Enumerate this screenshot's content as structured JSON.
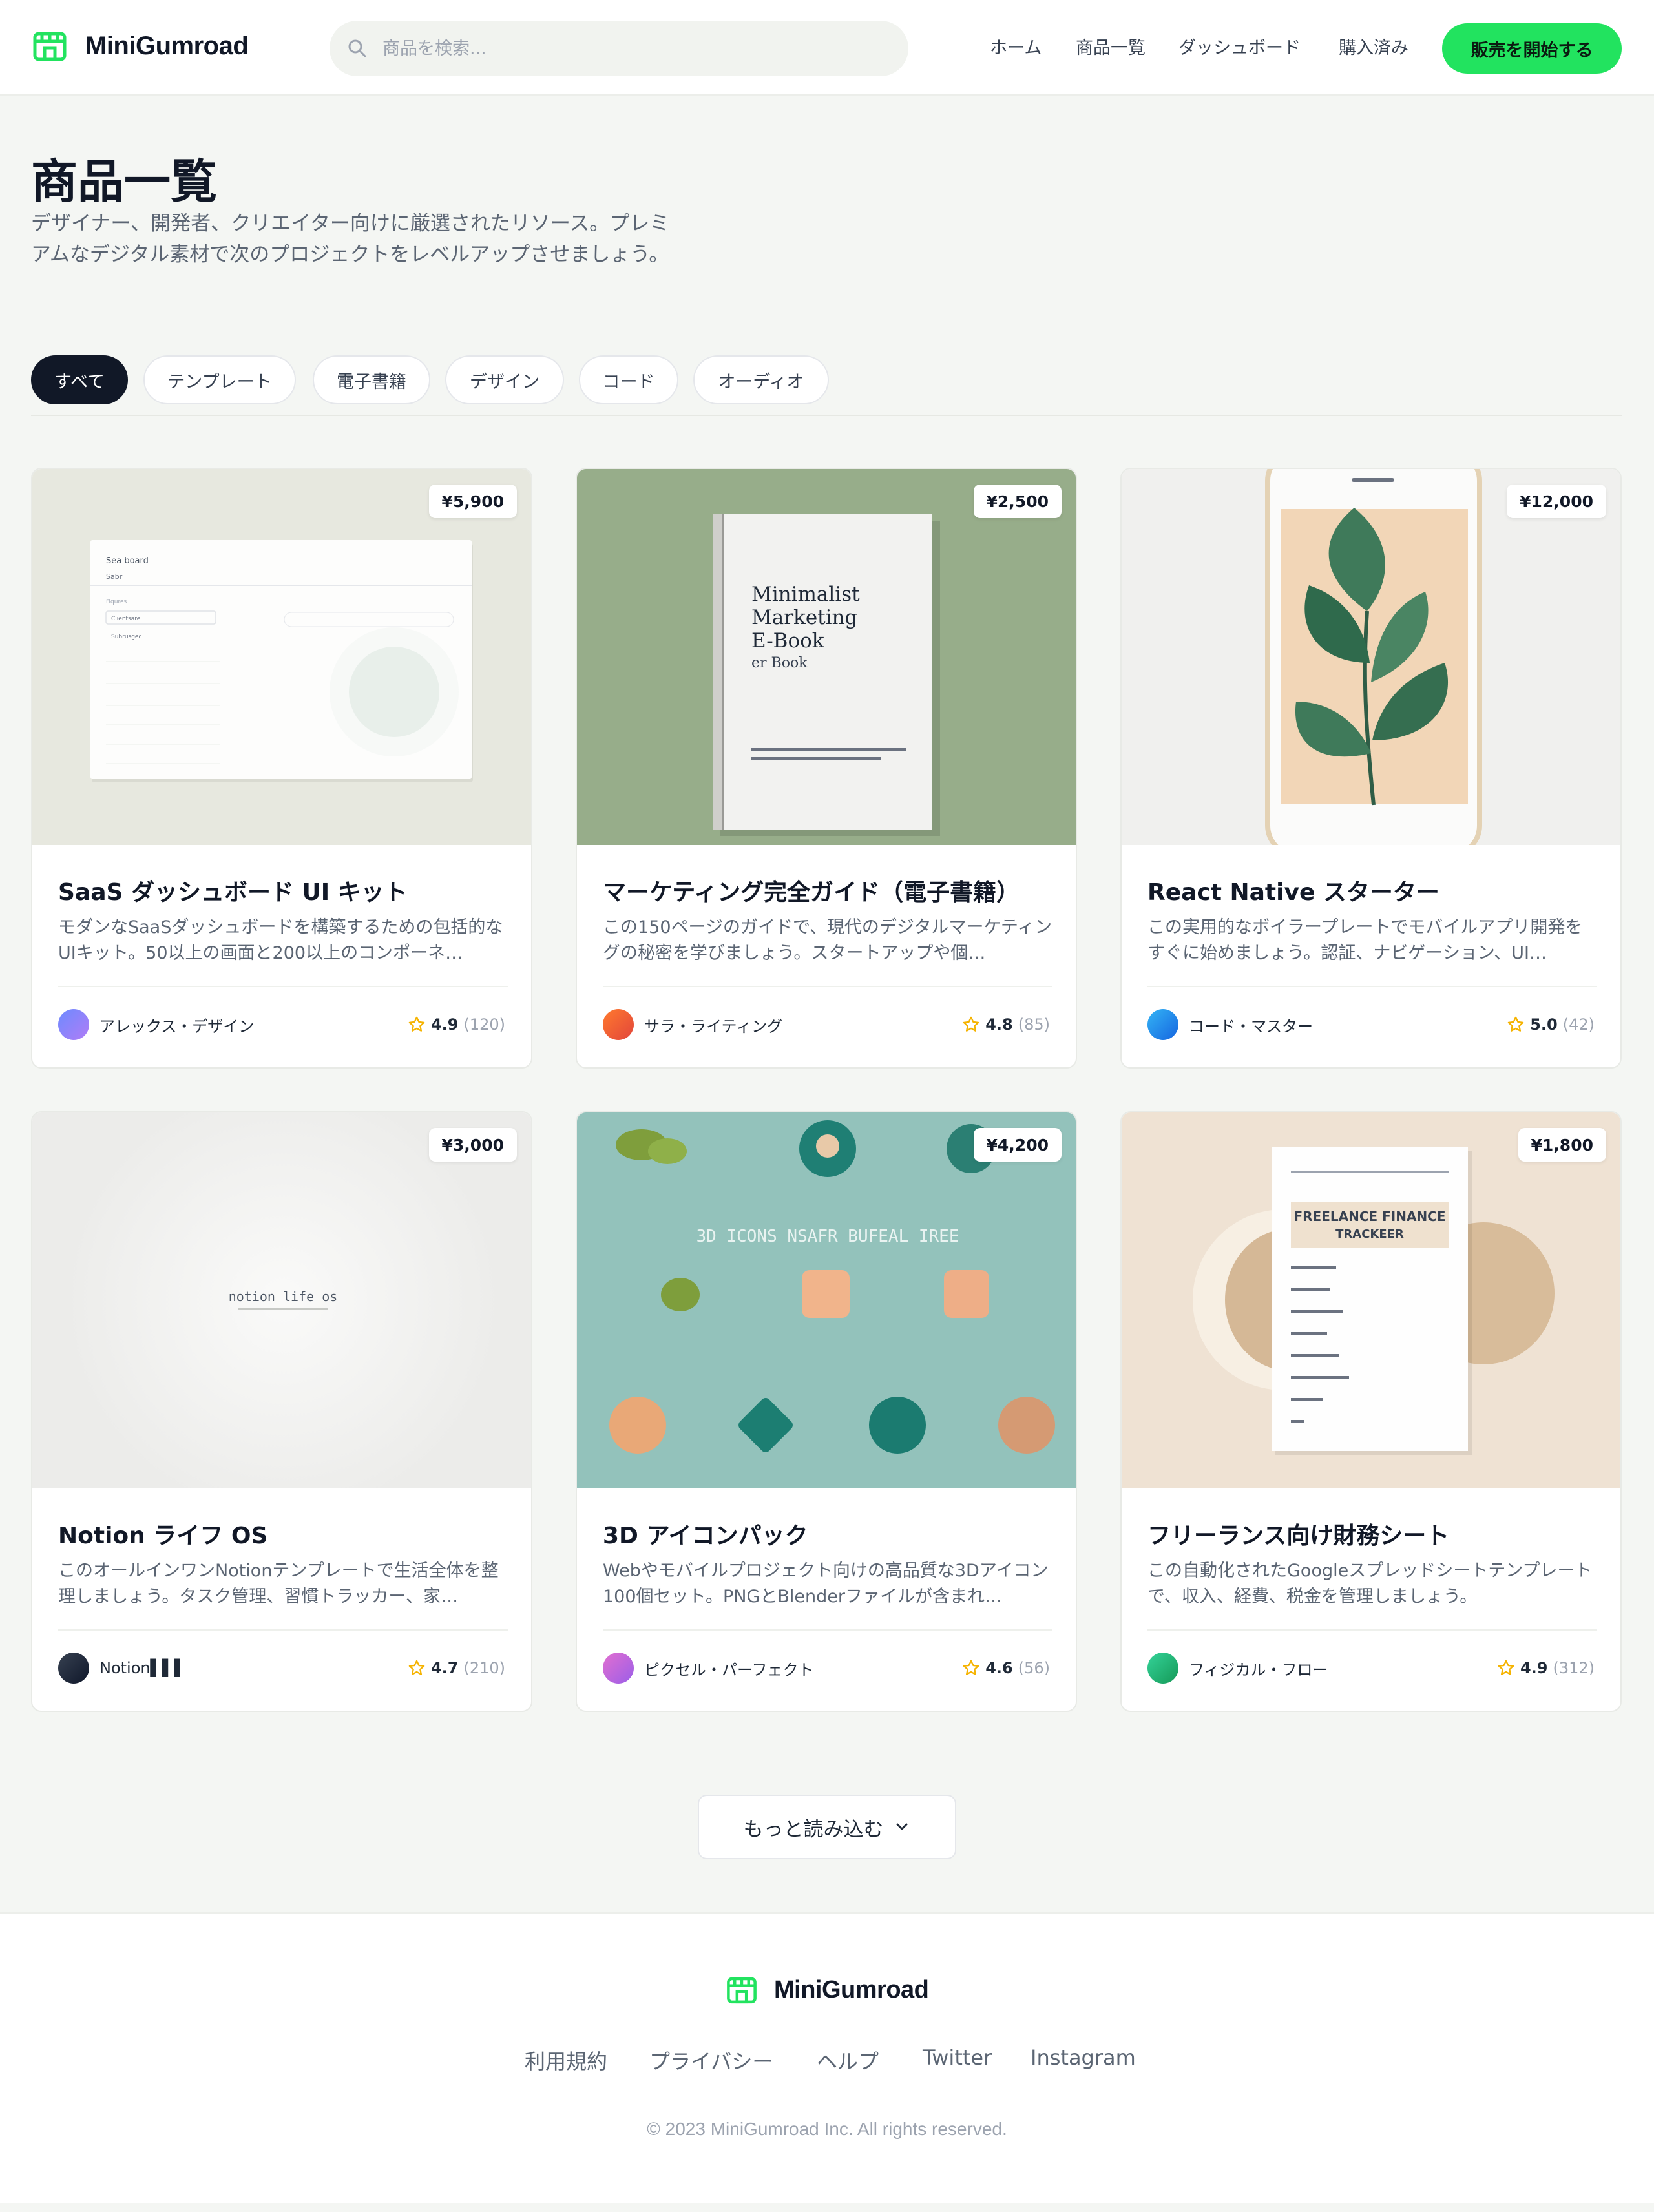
{
  "header": {
    "logo_text": "MiniGumroad",
    "search_placeholder": "商品を検索...",
    "nav": [
      "ホーム",
      "商品一覧",
      "ダッシュボード",
      "購入済み"
    ],
    "cta_label": "販売を開始する"
  },
  "hero": {
    "title": "商品一覧",
    "subtitle": "デザイナー、開発者、クリエイター向けに厳選されたリソース。プレミアムなデジタル素材で次のプロジェクトをレベルアップさせましょう。"
  },
  "filters": {
    "items": [
      "すべて",
      "テンプレート",
      "電子書籍",
      "デザイン",
      "コード",
      "オーディオ"
    ],
    "active": "すべて"
  },
  "products": [
    {
      "price": "¥5,900",
      "title": "SaaS ダッシュボード UI キット",
      "description": "モダンなSaaSダッシュボードを構築するための包括的なUIキット。50以上の画面と200以上のコンポーネ…",
      "author": "アレックス・デザイン",
      "rating": "4.9",
      "reviews": "(120)",
      "image_text": [
        "Sea board",
        "Sabr",
        "Fiqures",
        "Clientsare",
        "Subrusgec"
      ],
      "colors": {
        "bg": "#e7e8df",
        "avatar": "#8b7cf6"
      }
    },
    {
      "price": "¥2,500",
      "title": "マーケティング完全ガイド（電子書籍）",
      "description": "この150ページのガイドで、現代のデジタルマーケティングの秘密を学びましょう。スタートアップや個…",
      "author": "サラ・ライティング",
      "rating": "4.8",
      "reviews": "(85)",
      "image_text": [
        "Minimalist",
        "Marketing",
        "E-Book",
        "er Book"
      ],
      "colors": {
        "bg": "#97ad8a",
        "avatar": "#ef5a2a"
      }
    },
    {
      "price": "¥12,000",
      "title": "React Native スターター",
      "description": "この実用的なボイラープレートでモバイルアプリ開発をすぐに始めましょう。認証、ナビゲーション、UI…",
      "author": "コード・マスター",
      "rating": "5.0",
      "reviews": "(42)",
      "image_text": [],
      "colors": {
        "bg": "#f0f0ee",
        "avatar": "#1d8fe8"
      }
    },
    {
      "price": "¥3,000",
      "title": "Notion ライフ OS",
      "description": "このオールインワンNotionテンプレートで生活全体を整理しましょう。タスク管理、習慣トラッカー、家…",
      "author": "Notion▌▌▌",
      "rating": "4.7",
      "reviews": "(210)",
      "image_text": [
        "notion  life  os"
      ],
      "colors": {
        "bg": "#ededeb",
        "avatar": "#1f2937"
      }
    },
    {
      "price": "¥4,200",
      "title": "3D アイコンパック",
      "description": "Webやモバイルプロジェクト向けの高品質な3Dアイコン100個セット。PNGとBlenderファイルが含まれ…",
      "author": "ピクセル・パーフェクト",
      "rating": "4.6",
      "reviews": "(56)",
      "image_text": [
        "3D ICONS  NSAFR  BUFEAL  IREE"
      ],
      "colors": {
        "bg": "#93c2bb",
        "avatar": "#c86ee0"
      }
    },
    {
      "price": "¥1,800",
      "title": "フリーランス向け財務シート",
      "description": "この自動化されたGoogleスプレッドシートテンプレートで、収入、経費、税金を管理しましょう。",
      "author": "フィジカル・フロー",
      "rating": "4.9",
      "reviews": "(312)",
      "image_text": [
        "FREELANCE FINANCE",
        "TRACKEER"
      ],
      "colors": {
        "bg": "#efe2d3",
        "avatar": "#22b574"
      }
    }
  ],
  "load_more_label": "もっと読み込む",
  "footer": {
    "logo_text": "MiniGumroad",
    "links": [
      "利用規約",
      "プライバシー",
      "ヘルプ",
      "Twitter",
      "Instagram"
    ],
    "copyright": "© 2023 MiniGumroad Inc. All rights reserved."
  },
  "colors": {
    "accent": "#22e35f",
    "page_bg": "#f4f6f3",
    "text_dark": "#111827",
    "text_muted": "#5b6573",
    "star": "#f5b301"
  },
  "icons": [
    "store-icon",
    "search-icon",
    "star-icon",
    "chevron-down-icon"
  ]
}
